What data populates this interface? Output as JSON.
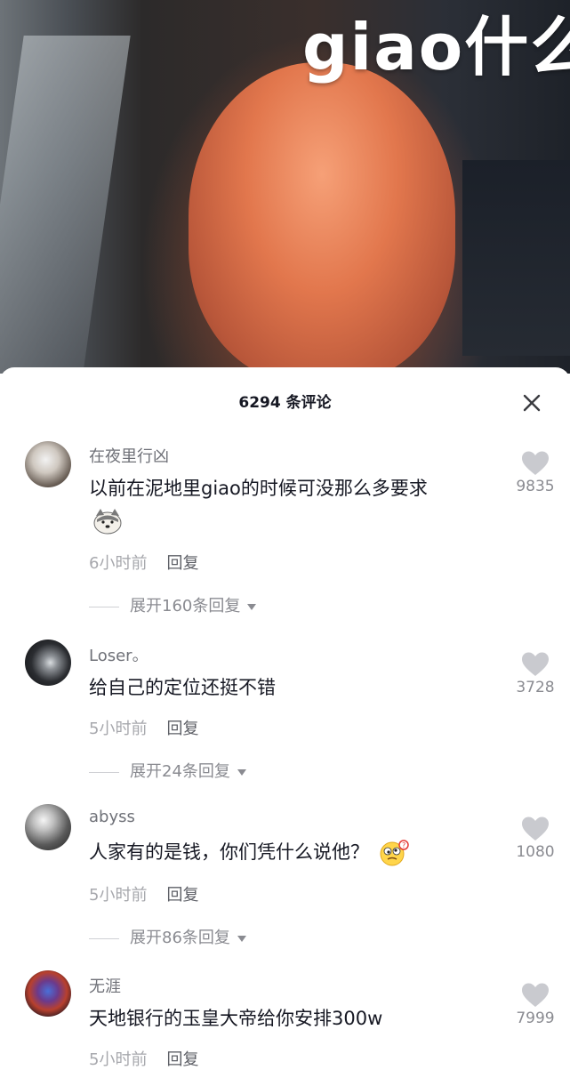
{
  "video": {
    "caption": "giao什么"
  },
  "comments_panel": {
    "count_title": "6294 条评论",
    "close_icon": "close-icon",
    "comments": [
      {
        "username": "在夜里行凶",
        "text": "以前在泥地里giao的时候可没那么多要求",
        "emoji": "doge-emoji",
        "time": "6小时前",
        "reply_label": "回复",
        "likes": "9835",
        "expand_label": "展开160条回复"
      },
      {
        "username": "Loser。",
        "text": "给自己的定位还挺不错",
        "time": "5小时前",
        "reply_label": "回复",
        "likes": "3728",
        "expand_label": "展开24条回复"
      },
      {
        "username": "abyss",
        "text": "人家有的是钱，你们凭什么说他？",
        "emoji": "dizzy-confused-emoji",
        "time": "5小时前",
        "reply_label": "回复",
        "likes": "1080",
        "expand_label": "展开86条回复"
      },
      {
        "username": "无涯",
        "text": "天地银行的玉皇大帝给你安排300w",
        "time": "5小时前",
        "reply_label": "回复",
        "likes": "7999"
      }
    ]
  },
  "colors": {
    "text_primary": "#161823",
    "text_secondary": "#6f7178",
    "like_icon": "#c9cacf"
  }
}
